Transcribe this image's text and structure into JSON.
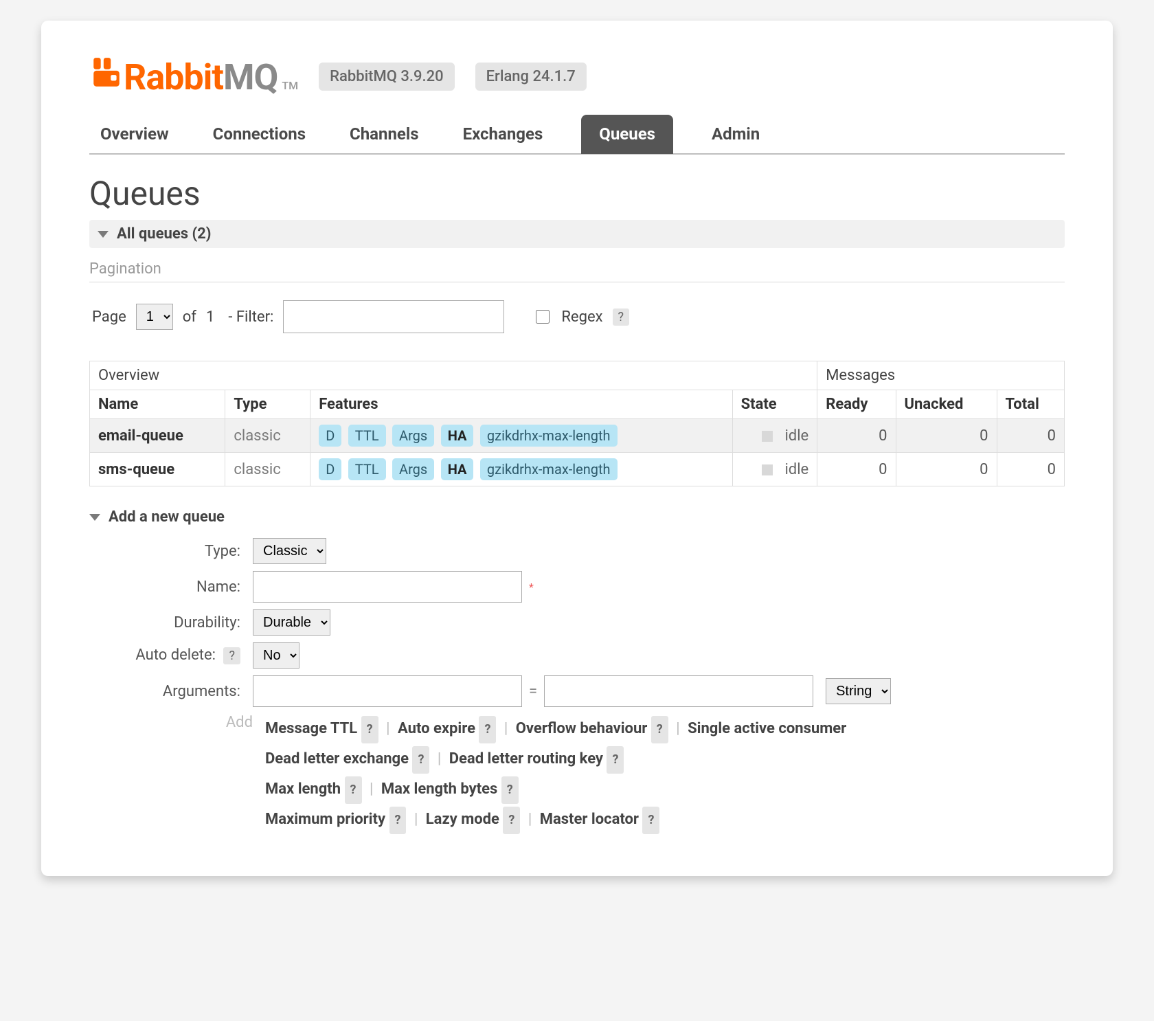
{
  "header": {
    "logo_rabbit": "Rabbit",
    "logo_mq": "MQ",
    "logo_tm": "TM",
    "version_chip": "RabbitMQ 3.9.20",
    "erlang_chip": "Erlang 24.1.7"
  },
  "tabs": {
    "overview": "Overview",
    "connections": "Connections",
    "channels": "Channels",
    "exchanges": "Exchanges",
    "queues": "Queues",
    "admin": "Admin"
  },
  "page": {
    "title": "Queues",
    "all_queues_header": "All queues (2)",
    "pagination_label": "Pagination",
    "page_label": "Page",
    "page_select": "1",
    "of_label": "of",
    "total_pages": "1",
    "filter_label": "- Filter:",
    "filter_value": "",
    "regex_label": "Regex",
    "regex_help": "?"
  },
  "table": {
    "group_overview": "Overview",
    "group_messages": "Messages",
    "col_name": "Name",
    "col_type": "Type",
    "col_features": "Features",
    "col_state": "State",
    "col_ready": "Ready",
    "col_unacked": "Unacked",
    "col_total": "Total",
    "rows": [
      {
        "name": "email-queue",
        "type": "classic",
        "feat_d": "D",
        "feat_ttl": "TTL",
        "feat_args": "Args",
        "feat_ha": "HA",
        "feat_policy": "gzikdrhx-max-length",
        "state": "idle",
        "ready": "0",
        "unacked": "0",
        "total": "0"
      },
      {
        "name": "sms-queue",
        "type": "classic",
        "feat_d": "D",
        "feat_ttl": "TTL",
        "feat_args": "Args",
        "feat_ha": "HA",
        "feat_policy": "gzikdrhx-max-length",
        "state": "idle",
        "ready": "0",
        "unacked": "0",
        "total": "0"
      }
    ]
  },
  "add": {
    "header": "Add a new queue",
    "type_label": "Type:",
    "type_value": "Classic",
    "name_label": "Name:",
    "name_value": "",
    "req_star": "*",
    "durability_label": "Durability:",
    "durability_value": "Durable",
    "autodelete_label": "Auto delete:",
    "autodelete_help": "?",
    "autodelete_value": "No",
    "arguments_label": "Arguments:",
    "arg_key": "",
    "arg_eq": "=",
    "arg_val": "",
    "arg_type": "String",
    "hints_add": "Add",
    "hints": {
      "msg_ttl": "Message TTL",
      "auto_expire": "Auto expire",
      "overflow": "Overflow behaviour",
      "single_active": "Single active consumer",
      "dlx": "Dead letter exchange",
      "dlrk": "Dead letter routing key",
      "max_len": "Max length",
      "max_len_bytes": "Max length bytes",
      "max_priority": "Maximum priority",
      "lazy": "Lazy mode",
      "master_locator": "Master locator",
      "q": "?"
    }
  }
}
